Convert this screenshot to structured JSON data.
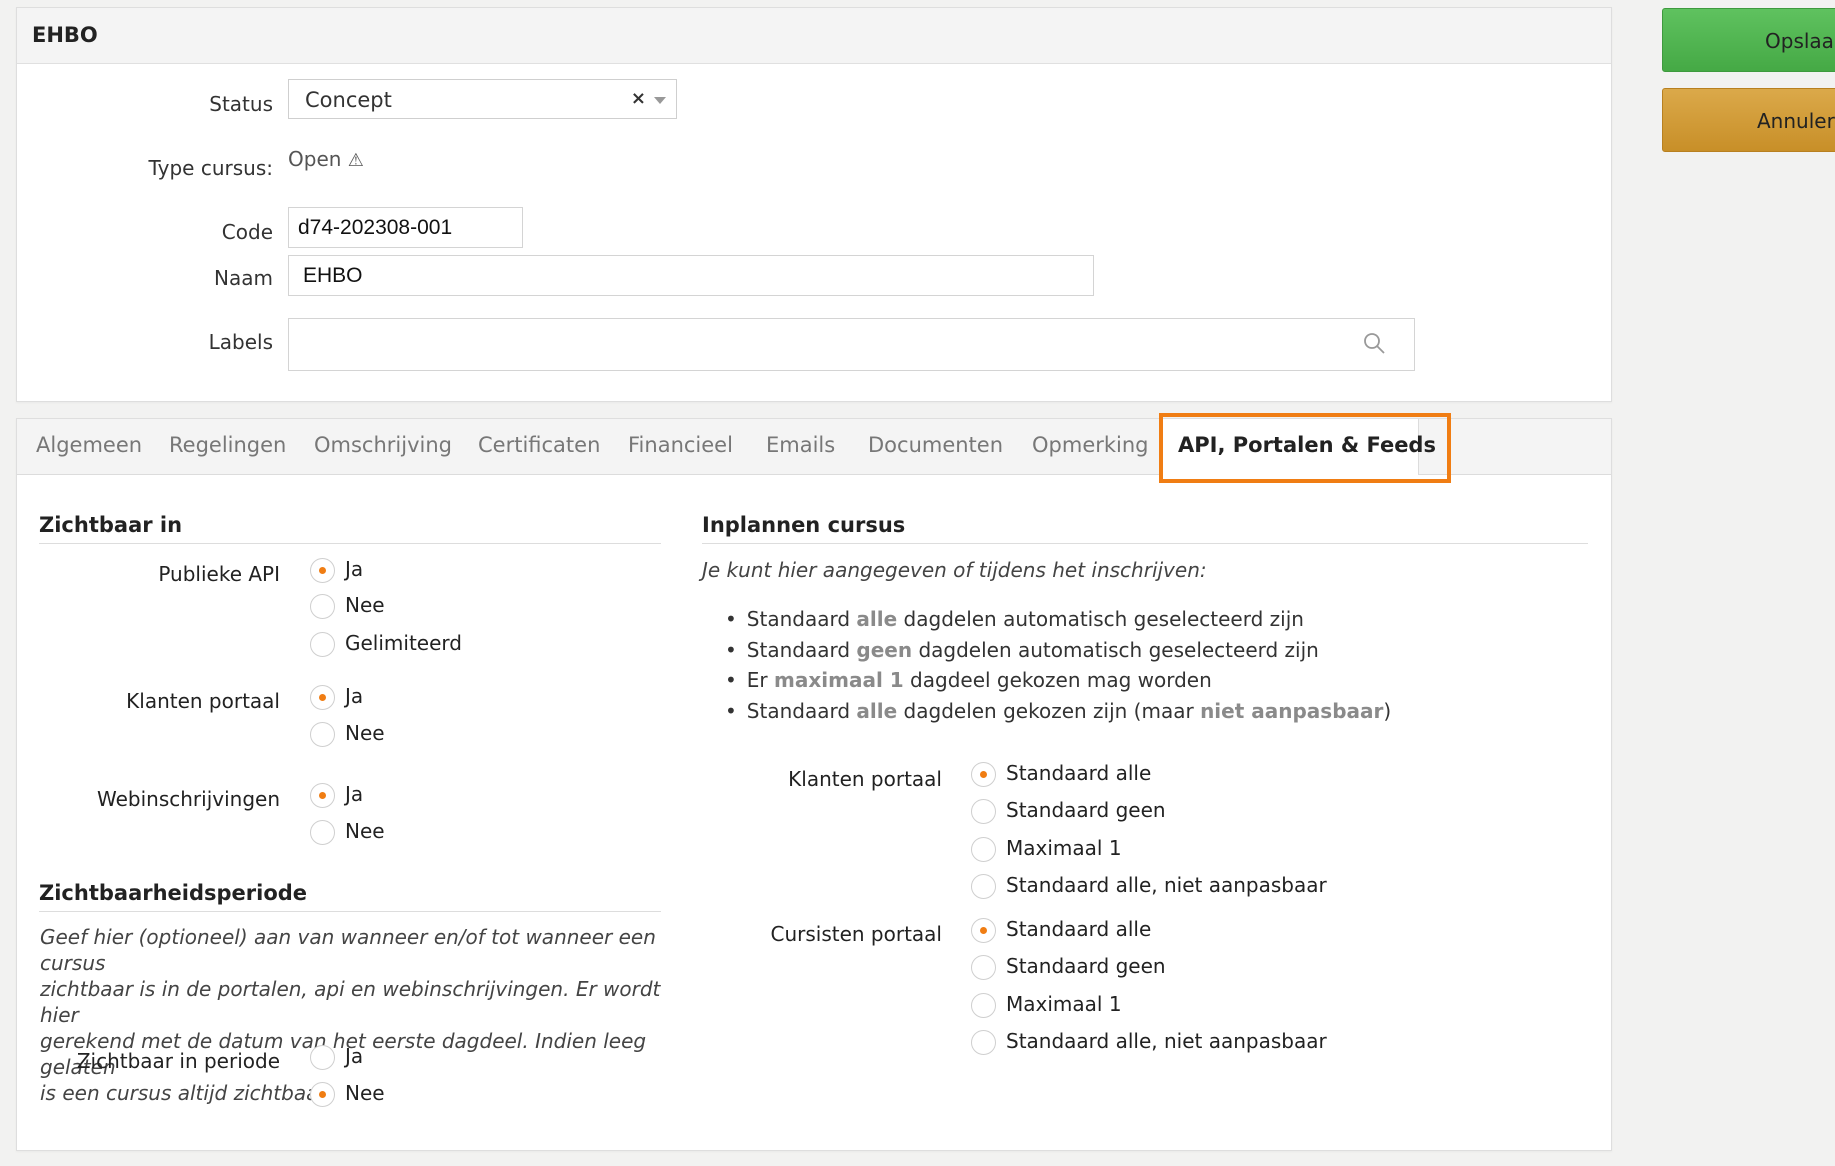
{
  "header": {
    "title": "EHBO"
  },
  "form": {
    "status_label": "Status",
    "status_value": "Concept",
    "status_clear": "×",
    "type_label": "Type cursus:",
    "type_value": "Open",
    "type_icon": "warning-icon",
    "code_label": "Code",
    "code_value": "d74-202308-001",
    "naam_label": "Naam",
    "naam_value": "EHBO",
    "labels_label": "Labels",
    "labels_value": "",
    "labels_icon": "search-icon"
  },
  "tabs": [
    {
      "label": "Algemeen"
    },
    {
      "label": "Regelingen"
    },
    {
      "label": "Omschrijving"
    },
    {
      "label": "Certificaten"
    },
    {
      "label": "Financieel"
    },
    {
      "label": "Emails"
    },
    {
      "label": "Documenten"
    },
    {
      "label": "Opmerking"
    },
    {
      "label": "API, Portalen & Feeds",
      "active": true
    }
  ],
  "zichtbaar": {
    "title": "Zichtbaar in",
    "publieke_api": {
      "label": "Publieke API",
      "options": [
        "Ja",
        "Nee",
        "Gelimiteerd"
      ],
      "selected": "Ja"
    },
    "klanten_portaal": {
      "label": "Klanten portaal",
      "options": [
        "Ja",
        "Nee"
      ],
      "selected": "Ja"
    },
    "webinschrijvingen": {
      "label": "Webinschrijvingen",
      "options": [
        "Ja",
        "Nee"
      ],
      "selected": "Ja"
    }
  },
  "periode": {
    "title": "Zichtbaarheidsperiode",
    "description_lines": [
      "Geef hier (optioneel) aan van wanneer en/of tot wanneer een cursus",
      "zichtbaar is in de portalen, api en webinschrijvingen. Er wordt hier",
      "gerekend met de datum van het eerste dagdeel. Indien leeg gelaten",
      "is een cursus altijd zichtbaar."
    ],
    "zichtbaar_in_periode": {
      "label": "Zichtbaar in periode",
      "options": [
        "Ja",
        "Nee"
      ],
      "selected": "Nee"
    }
  },
  "inplannen": {
    "title": "Inplannen cursus",
    "intro": "Je kunt hier aangegeven of tijdens het inschrijven:",
    "bullets": [
      {
        "before": "Standaard ",
        "emph": "alle",
        "after": " dagdelen automatisch geselecteerd zijn",
        "emph2": "",
        "after2": ""
      },
      {
        "before": "Standaard ",
        "emph": "geen",
        "after": " dagdelen automatisch geselecteerd zijn",
        "emph2": "",
        "after2": ""
      },
      {
        "before": "Er ",
        "emph": "maximaal 1",
        "after": " dagdeel gekozen mag worden",
        "emph2": "",
        "after2": ""
      },
      {
        "before": "Standaard ",
        "emph": "alle",
        "after": " dagdelen gekozen zijn (maar ",
        "emph2": "niet aanpasbaar",
        "after2": ")"
      }
    ],
    "klanten_portaal": {
      "label": "Klanten portaal",
      "options": [
        "Standaard alle",
        "Standaard geen",
        "Maximaal 1",
        "Standaard alle, niet aanpasbaar"
      ],
      "selected": "Standaard alle"
    },
    "cursisten_portaal": {
      "label": "Cursisten portaal",
      "options": [
        "Standaard alle",
        "Standaard geen",
        "Maximaal 1",
        "Standaard alle, niet aanpasbaar"
      ],
      "selected": "Standaard alle"
    }
  },
  "actions": {
    "save_label": "Opslaan",
    "cancel_label": "Annuleren"
  },
  "colors": {
    "accent": "#f07d13",
    "save": "#4cb34c",
    "cancel": "#cf9630"
  }
}
